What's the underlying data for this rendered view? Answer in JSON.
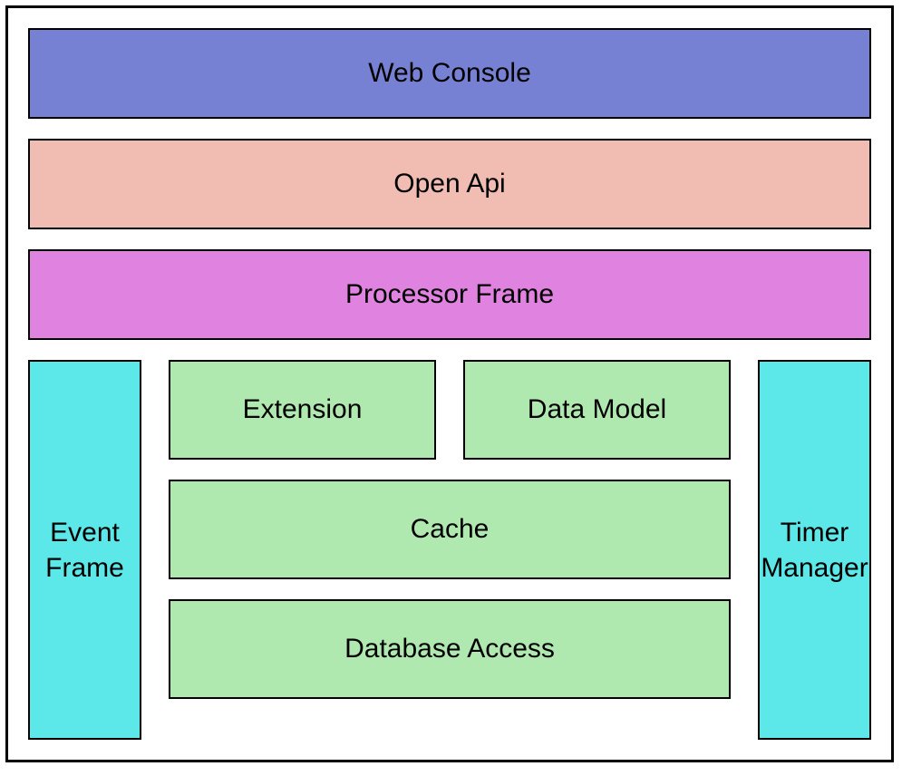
{
  "layers": {
    "web_console": "Web Console",
    "open_api": "Open Api",
    "processor_frame": "Processor Frame"
  },
  "bottom": {
    "event_frame": "Event Frame",
    "timer_manager": "Timer Manager",
    "middle": {
      "extension": "Extension",
      "data_model": "Data Model",
      "cache": "Cache",
      "database_access": "Database Access"
    }
  },
  "colors": {
    "web_console": "#7781d4",
    "open_api": "#f1bcb2",
    "processor_frame": "#e082e0",
    "cyan": "#5ce8e8",
    "green": "#b0e9b0"
  }
}
